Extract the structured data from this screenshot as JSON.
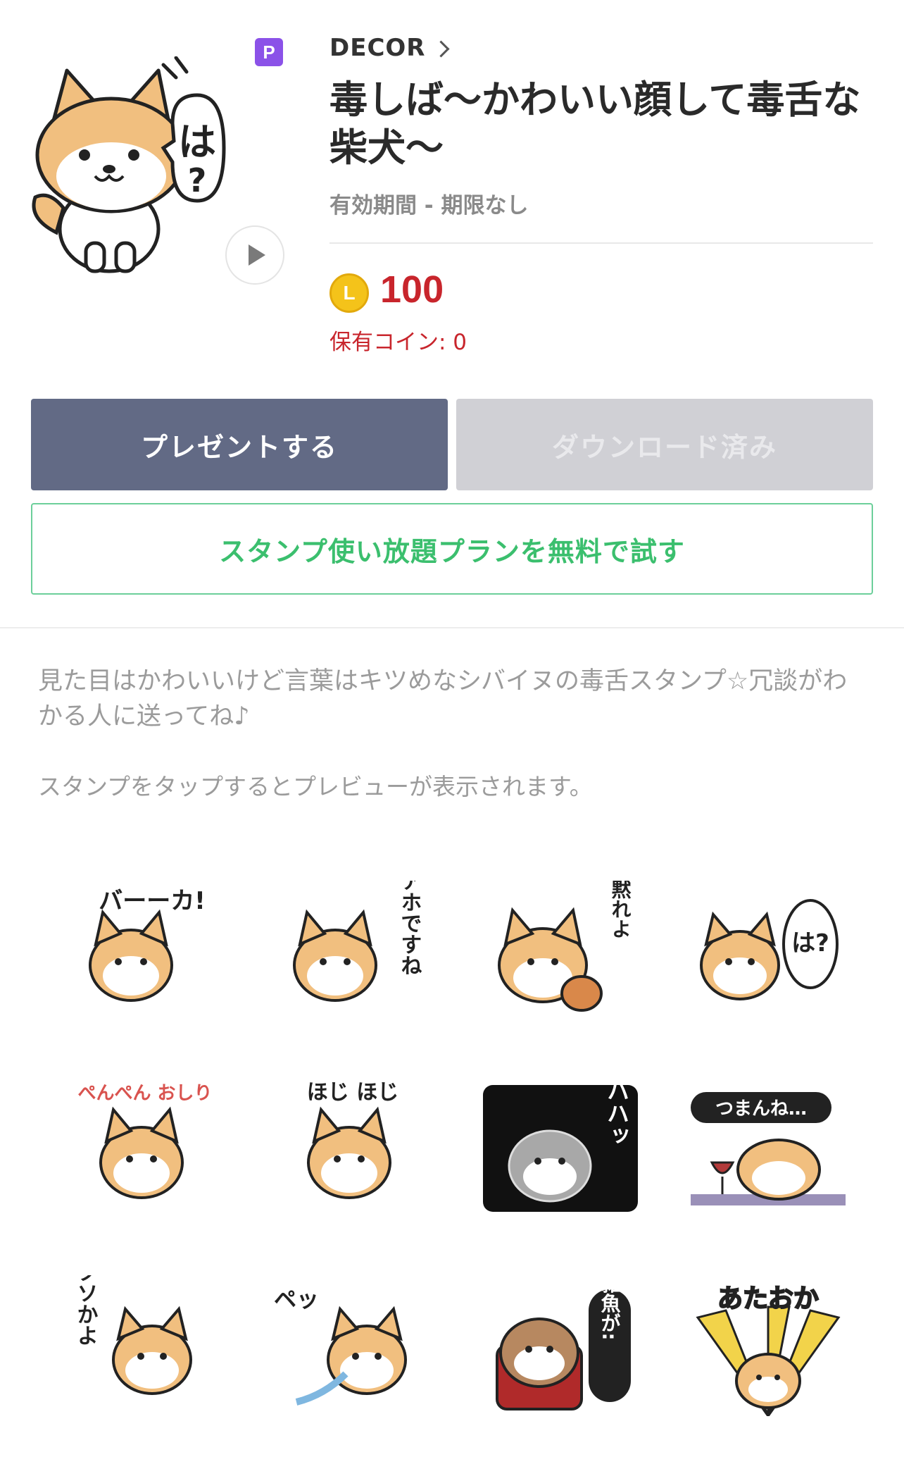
{
  "product": {
    "badge": "P",
    "author": "DECOR",
    "title": "毒しば〜かわいい顔して毒舌な柴犬〜",
    "validity": "有効期間 - 期限なし",
    "coin_symbol": "L",
    "price": "100",
    "owned_coins": "保有コイン: 0",
    "main_sticker_text": "は?"
  },
  "actions": {
    "present": "プレゼントする",
    "download": "ダウンロード済み",
    "trial": "スタンプ使い放題プランを無料で試す"
  },
  "description": "見た目はかわいいけど言葉はキツめなシバイヌの毒舌スタンプ☆冗談がわかる人に送ってね♪",
  "preview_hint": "スタンプをタップするとプレビューが表示されます。",
  "stickers": [
    {
      "text": "バーーカ!"
    },
    {
      "text": "アホですね"
    },
    {
      "text": "黙れよ"
    },
    {
      "text": "は?"
    },
    {
      "text": "ぺんぺん おしり"
    },
    {
      "text": "ほじ ほじ"
    },
    {
      "text": "ハハッ"
    },
    {
      "text": "つまんね…"
    },
    {
      "text": "クソかよ"
    },
    {
      "text": "ペッ"
    },
    {
      "text": "雑魚が:"
    },
    {
      "text": "あたおか"
    }
  ],
  "colors": {
    "present_button": "#626a85",
    "download_button_disabled": "#d0d0d5",
    "trial_text": "#3bbf6e",
    "price": "#c8252c",
    "badge": "#8b52e8",
    "coin": "#f4c31a"
  }
}
